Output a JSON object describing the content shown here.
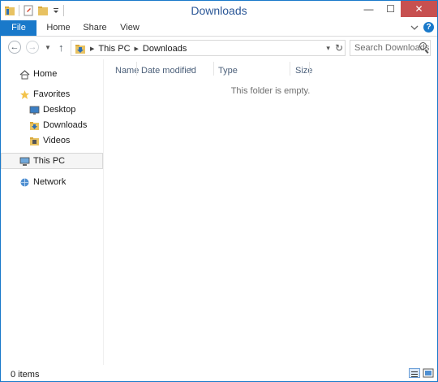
{
  "window": {
    "title": "Downloads"
  },
  "titlebar": {
    "minimize": "—",
    "maximize": "☐",
    "close": "✕"
  },
  "ribbon": {
    "tabs": [
      "File",
      "Home",
      "Share",
      "View"
    ],
    "expand_icon": "chevron-down-icon",
    "help_label": "?"
  },
  "nav": {
    "back_glyph": "←",
    "forward_glyph": "→",
    "recent_glyph": "▼",
    "up_glyph": "↑"
  },
  "address": {
    "crumbs": [
      "This PC",
      "Downloads"
    ],
    "separator": "▶",
    "dropdown_glyph": "▾",
    "refresh_glyph": "↻"
  },
  "search": {
    "placeholder": "Search Downloads"
  },
  "sidebar": {
    "items": [
      {
        "label": "Home",
        "icon": "home-icon"
      },
      {
        "label": "Favorites",
        "icon": "star-icon"
      },
      {
        "label": "Desktop",
        "icon": "desktop-icon"
      },
      {
        "label": "Downloads",
        "icon": "downloads-folder-icon"
      },
      {
        "label": "Videos",
        "icon": "videos-folder-icon"
      },
      {
        "label": "This PC",
        "icon": "computer-icon"
      },
      {
        "label": "Network",
        "icon": "network-icon"
      }
    ]
  },
  "columns": [
    "Name",
    "Date modified",
    "Type",
    "Size"
  ],
  "content": {
    "empty_message": "This folder is empty."
  },
  "status": {
    "item_count": "0 items"
  },
  "colors": {
    "accent": "#1979ca",
    "title_text": "#2b5797",
    "close_button": "#c75050"
  }
}
